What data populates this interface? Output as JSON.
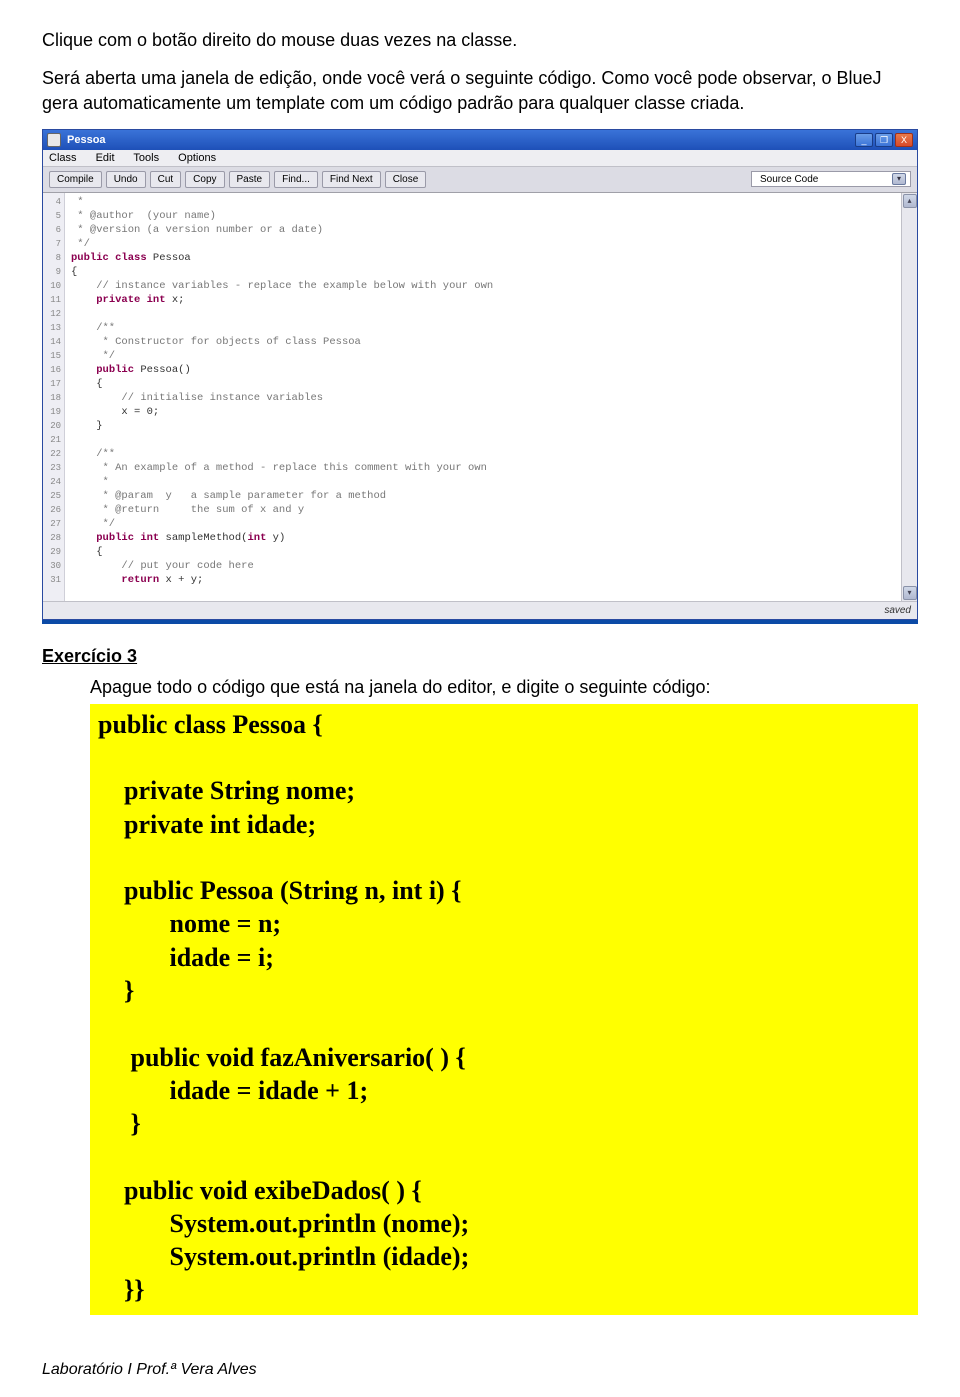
{
  "doc": {
    "p1": "Clique com o botão direito do mouse duas vezes na classe.",
    "p2": "Será aberta uma janela de edição, onde você verá o seguinte código. Como você pode observar, o BlueJ gera automaticamente um template com um código padrão para qualquer classe criada."
  },
  "bluej": {
    "title": "Pessoa",
    "winbtns": {
      "min": "_",
      "max": "❐",
      "close": "X"
    },
    "menu": {
      "class": "Class",
      "edit": "Edit",
      "tools": "Tools",
      "options": "Options"
    },
    "toolbar": {
      "compile": "Compile",
      "undo": "Undo",
      "cut": "Cut",
      "copy": "Copy",
      "paste": "Paste",
      "find": "Find...",
      "findnext": "Find Next",
      "close": "Close",
      "dropdown_text": "Source Code",
      "chev": "▾",
      "sb_up": "▴",
      "sb_dn": "▾"
    },
    "gutter_start": 4,
    "gutter_end": 31,
    "code": {
      "l4": " *",
      "l5": " * @author  (your name)",
      "l6": " * @version (a version number or a date)",
      "l7": " */",
      "l8a": "public",
      "l8b": " class",
      "l8c": " Pessoa",
      "l9": "{",
      "l10a": "    ",
      "l10b": "// instance variables - replace the example below with your own",
      "l11a": "    ",
      "l11b": "private",
      "l11c": " int",
      "l11d": " x;",
      "l12": "",
      "l13": "    /**",
      "l14": "     * Constructor for objects of class Pessoa",
      "l15": "     */",
      "l16a": "    ",
      "l16b": "public",
      "l16c": " Pessoa()",
      "l17": "    {",
      "l18a": "        ",
      "l18b": "// initialise instance variables",
      "l19": "        x = 0;",
      "l20": "    }",
      "l21": "",
      "l22": "    /**",
      "l23": "     * An example of a method - replace this comment with your own",
      "l24": "     *",
      "l25": "     * @param  y   a sample parameter for a method",
      "l26": "     * @return     the sum of x and y",
      "l27": "     */",
      "l28a": "    ",
      "l28b": "public",
      "l28c": " int",
      "l28d": " sampleMethod(",
      "l28e": "int",
      "l28f": " y)",
      "l29": "    {",
      "l30a": "        ",
      "l30b": "// put your code here",
      "l31a": "        ",
      "l31b": "return",
      "l31c": " x + y;"
    },
    "status": "saved"
  },
  "exercise": {
    "heading": "Exercício 3",
    "instr": "Apague todo o código que está na janela do editor, e digite o seguinte código:",
    "code": "public class Pessoa {\n\n    private String nome;\n    private int idade;\n\n    public Pessoa (String n, int i) {\n           nome = n;\n           idade = i;\n    }\n\n     public void fazAniversario( ) {\n           idade = idade + 1;\n     }\n\n    public void exibeDados( ) {\n           System.out.println (nome);\n           System.out.println (idade);\n    }}"
  },
  "footer": "Laboratório I Prof.ª Vera Alves"
}
